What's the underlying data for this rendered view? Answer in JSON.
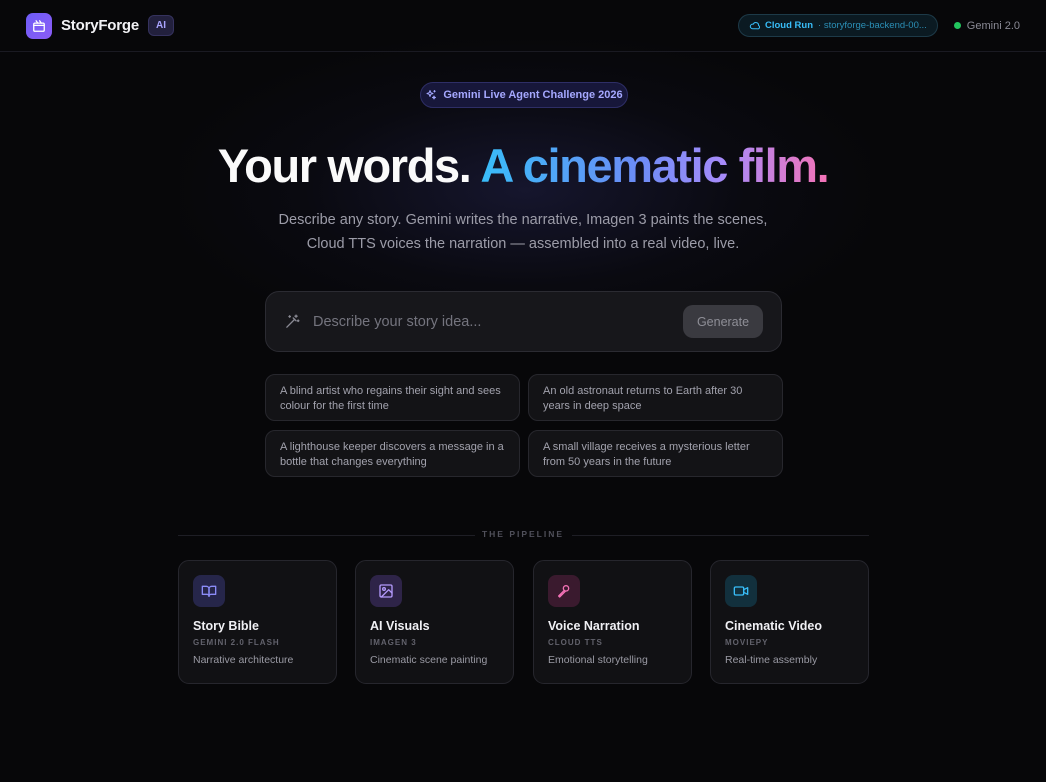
{
  "header": {
    "brand": "StoryForge",
    "badge": "AI",
    "cloud_run_label": "Cloud Run",
    "cloud_run_service": "· storyforge-backend-00...",
    "model_status": "Gemini 2.0",
    "status_color": "#22c55e"
  },
  "hero": {
    "challenge_pill": "Gemini Live Agent Challenge 2026",
    "headline_plain": "Your words.",
    "headline_gradient": "A cinematic film.",
    "subtitle_line1": "Describe any story. Gemini writes the narrative, Imagen 3 paints the scenes,",
    "subtitle_line2": "Cloud TTS voices the narration — assembled into a real video, live."
  },
  "prompt": {
    "placeholder": "Describe your story idea...",
    "value": "",
    "generate_label": "Generate"
  },
  "suggestions": [
    "A blind artist who regains their sight and sees colour for the first time",
    "An old astronaut returns to Earth after 30 years in deep space",
    "A lighthouse keeper discovers a message in a bottle that changes everything",
    "A small village receives a mysterious letter from 50 years in the future"
  ],
  "pipeline": {
    "label": "THE PIPELINE",
    "cards": [
      {
        "title": "Story Bible",
        "model": "GEMINI 2.0 FLASH",
        "desc": "Narrative architecture",
        "icon": "book-icon",
        "accent": "#7c7cf6"
      },
      {
        "title": "AI Visuals",
        "model": "IMAGEN 3",
        "desc": "Cinematic scene painting",
        "icon": "image-icon",
        "accent": "#a78bfa"
      },
      {
        "title": "Voice Narration",
        "model": "CLOUD TTS",
        "desc": "Emotional storytelling",
        "icon": "microphone-icon",
        "accent": "#f472b6"
      },
      {
        "title": "Cinematic Video",
        "model": "MOVIEPY",
        "desc": "Real-time assembly",
        "icon": "video-camera-icon",
        "accent": "#38bdf8"
      }
    ]
  }
}
